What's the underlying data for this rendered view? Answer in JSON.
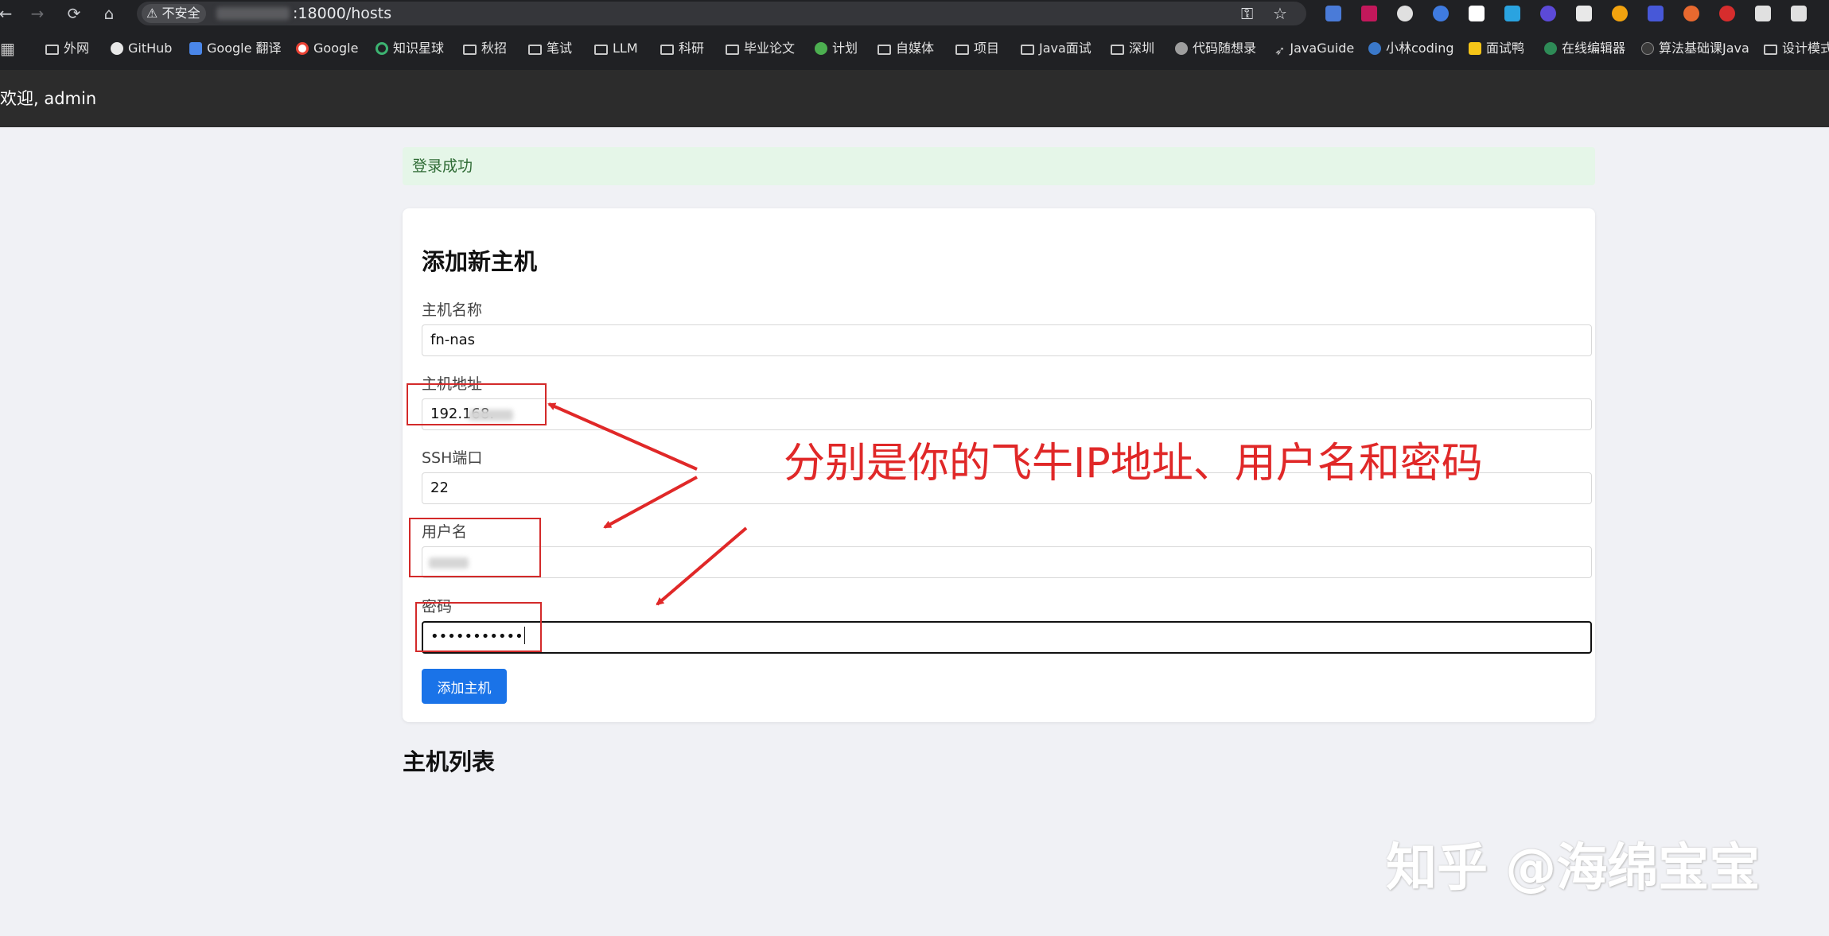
{
  "browser": {
    "security_label": "不安全",
    "url_visible": ":18000/hosts",
    "bookmarks": [
      {
        "label": "外网",
        "icon": "folder-icon"
      },
      {
        "label": "GitHub",
        "icon": "github-icon"
      },
      {
        "label": "Google 翻译",
        "icon": "google-translate-icon"
      },
      {
        "label": "Google",
        "icon": "google-icon"
      },
      {
        "label": "知识星球",
        "icon": "planet-icon"
      },
      {
        "label": "秋招",
        "icon": "folder-icon"
      },
      {
        "label": "笔试",
        "icon": "folder-icon"
      },
      {
        "label": "LLM",
        "icon": "folder-icon"
      },
      {
        "label": "科研",
        "icon": "folder-icon"
      },
      {
        "label": "毕业论文",
        "icon": "folder-icon"
      },
      {
        "label": "计划",
        "icon": "globe-icon"
      },
      {
        "label": "自媒体",
        "icon": "folder-icon"
      },
      {
        "label": "项目",
        "icon": "folder-icon"
      },
      {
        "label": "Java面试",
        "icon": "folder-icon"
      },
      {
        "label": "深圳",
        "icon": "folder-icon"
      },
      {
        "label": "代码随想录",
        "icon": "globe-icon"
      },
      {
        "label": "JavaGuide",
        "icon": "javaguide-icon"
      },
      {
        "label": "小林coding",
        "icon": "xiaolin-icon"
      },
      {
        "label": "面试鸭",
        "icon": "duck-icon"
      },
      {
        "label": "在线编辑器",
        "icon": "editor-icon"
      },
      {
        "label": "算法基础课Java",
        "icon": "github-icon"
      },
      {
        "label": "设计模式",
        "icon": "folder-icon"
      }
    ]
  },
  "app": {
    "welcome": "欢迎, admin",
    "flash": "登录成功",
    "form": {
      "title": "添加新主机",
      "fields": {
        "name": {
          "label": "主机名称",
          "value": "fn-nas"
        },
        "host": {
          "label": "主机地址",
          "value": "192.168."
        },
        "port": {
          "label": "SSH端口",
          "value": "22"
        },
        "user": {
          "label": "用户名",
          "value": ""
        },
        "password": {
          "label": "密码",
          "value": "•••••••••••"
        }
      },
      "submit_label": "添加主机"
    },
    "list_title": "主机列表"
  },
  "annotation": {
    "text": "分别是你的飞牛IP地址、用户名和密码",
    "color": "#e02828"
  },
  "watermark": "知乎 @海绵宝宝"
}
